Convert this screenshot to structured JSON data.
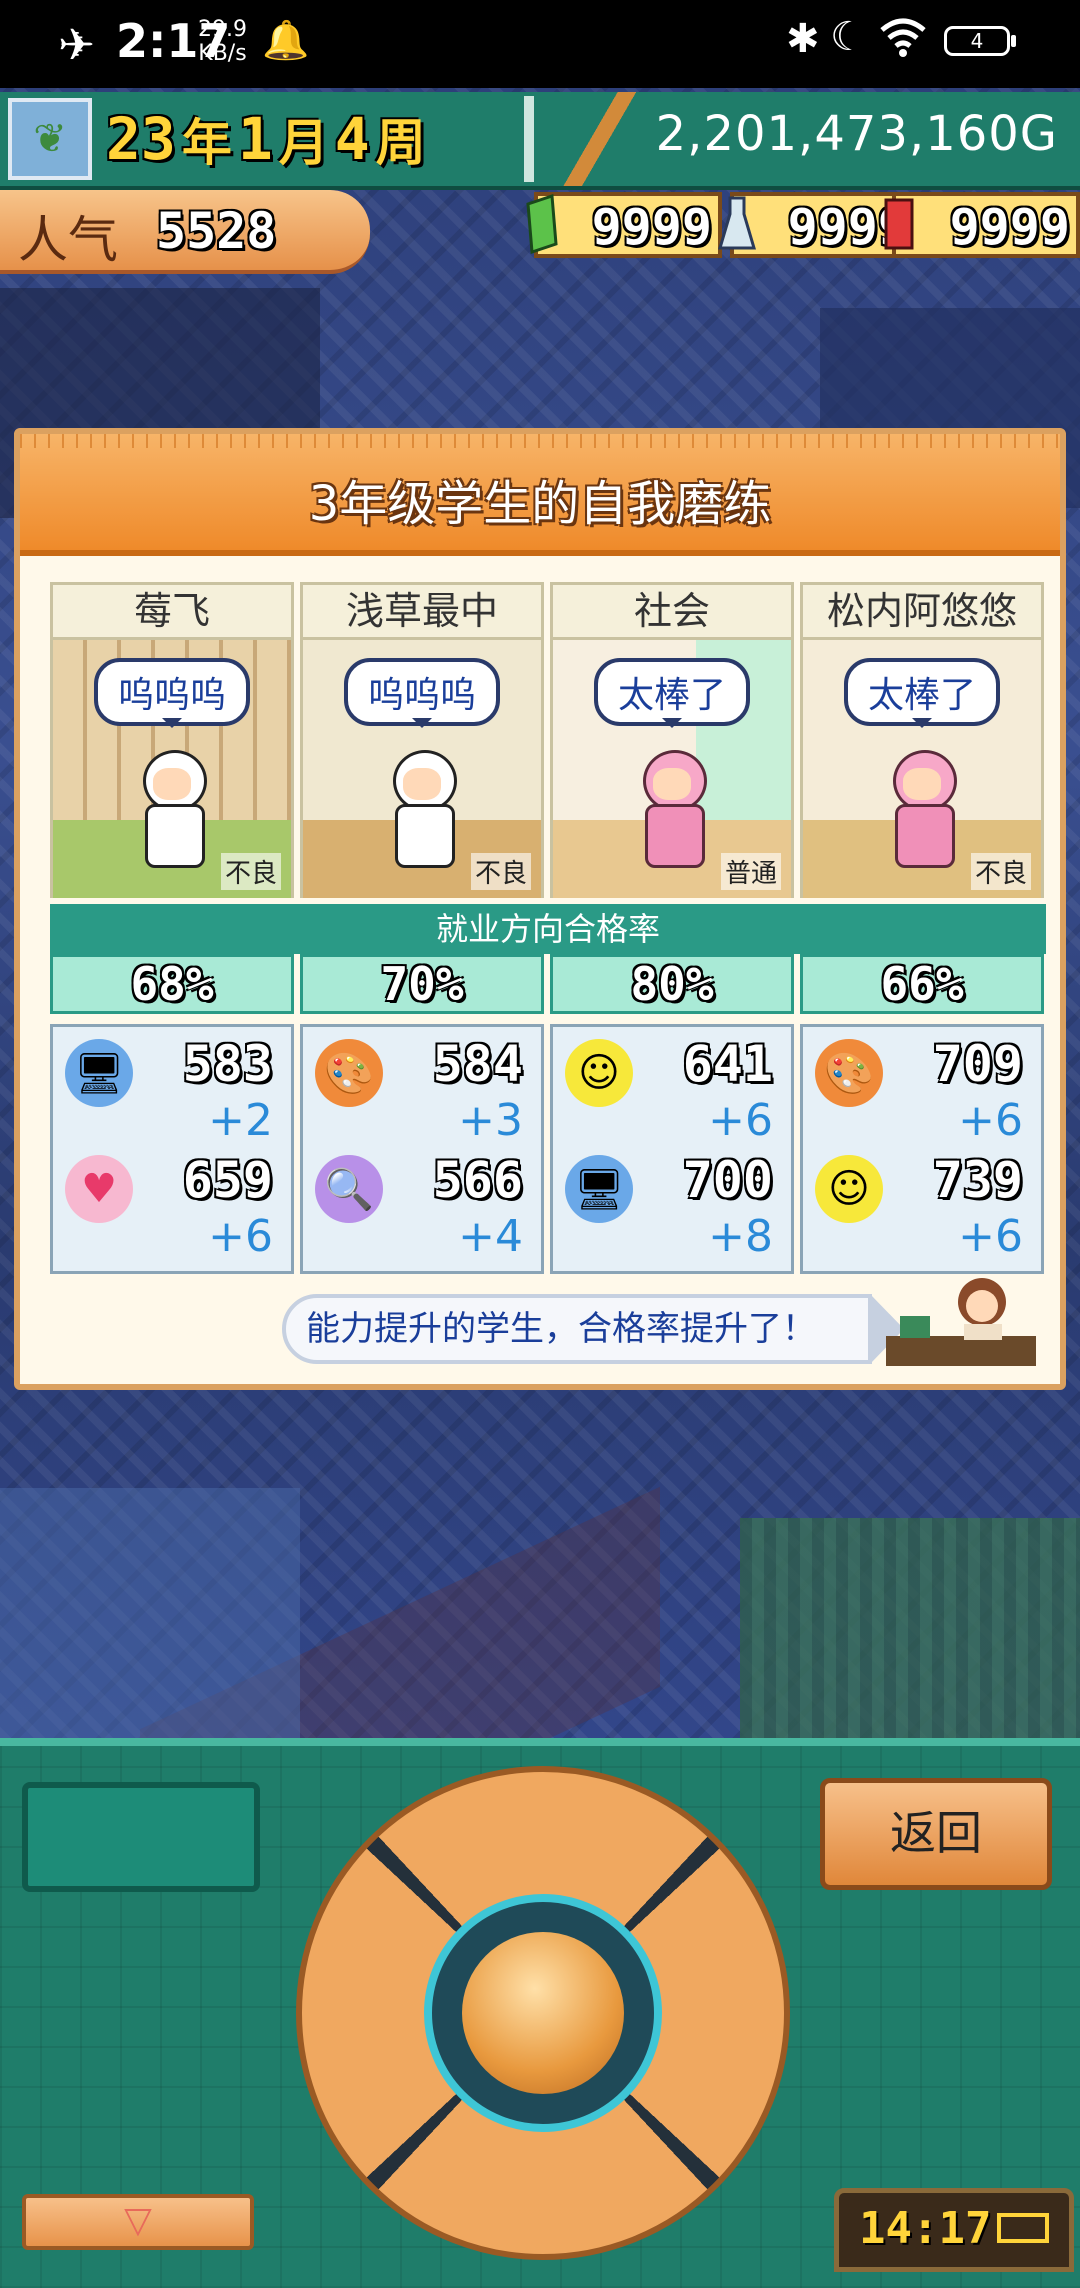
{
  "status_bar": {
    "time": "2:17",
    "net_speed_value": "29.9",
    "net_speed_unit": "KB/s",
    "battery": "4"
  },
  "hud": {
    "year": "23",
    "year_unit": "年",
    "month": "1",
    "month_unit": "月",
    "week": "4",
    "week_unit": "周",
    "money": "2,201,473,160G",
    "popularity_label": "人气",
    "popularity_value": "5528",
    "resources": [
      "9999",
      "9999",
      "9999"
    ]
  },
  "panel": {
    "title": "3年级学生的自我磨练",
    "pass_rate_label": "就业方向合格率",
    "message": "能力提升的学生，合格率提升了！",
    "students": [
      {
        "name": "莓飞",
        "speech": "呜呜呜",
        "grade": "不良",
        "pass_rate": "68%",
        "stats": [
          {
            "icon": "computer-icon",
            "value": "583",
            "gain": "+2"
          },
          {
            "icon": "heart-icon",
            "value": "659",
            "gain": "+6"
          }
        ]
      },
      {
        "name": "浅草最中",
        "speech": "呜呜呜",
        "grade": "不良",
        "pass_rate": "70%",
        "stats": [
          {
            "icon": "art-easel-icon",
            "value": "584",
            "gain": "+3"
          },
          {
            "icon": "magnifier-icon",
            "value": "566",
            "gain": "+4"
          }
        ]
      },
      {
        "name": "社会",
        "speech": "太棒了",
        "grade": "普通",
        "pass_rate": "80%",
        "stats": [
          {
            "icon": "smile-icon",
            "value": "641",
            "gain": "+6"
          },
          {
            "icon": "computer-icon",
            "value": "700",
            "gain": "+8"
          }
        ]
      },
      {
        "name": "松内阿悠悠",
        "speech": "太棒了",
        "grade": "不良",
        "pass_rate": "66%",
        "stats": [
          {
            "icon": "art-easel-icon",
            "value": "709",
            "gain": "+6"
          },
          {
            "icon": "smile-icon",
            "value": "739",
            "gain": "+6"
          }
        ]
      }
    ]
  },
  "controls": {
    "back_label": "返回",
    "down_arrow": "▽",
    "clock_time": "14:17"
  },
  "colors": {
    "panel_header": "#ef8a2a",
    "rate_header": "#2a9a86",
    "gain_text": "#2a8ad8",
    "hud_bg": "#1f7d6a"
  }
}
